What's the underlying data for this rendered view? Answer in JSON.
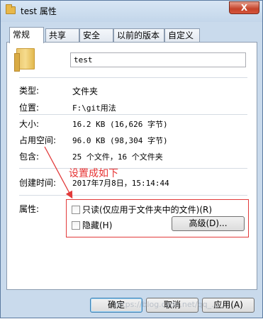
{
  "window": {
    "title": "test 属性",
    "close_label": "X"
  },
  "tabs": [
    {
      "label": "常规",
      "active": true
    },
    {
      "label": "共享",
      "active": false
    },
    {
      "label": "安全",
      "active": false
    },
    {
      "label": "以前的版本",
      "active": false
    },
    {
      "label": "自定义",
      "active": false
    }
  ],
  "general": {
    "folder_name": "test",
    "rows": [
      {
        "label": "类型:",
        "value": "文件夹"
      },
      {
        "label": "位置:",
        "value": "F:\\git用法"
      },
      {
        "label": "大小:",
        "value": "16.2 KB (16,626 字节)"
      },
      {
        "label": "占用空间:",
        "value": "96.0 KB (98,304 字节)"
      },
      {
        "label": "包含:",
        "value": "25 个文件，16 个文件夹"
      },
      {
        "label": "创建时间:",
        "value": "2017年7月8日，15:14:44"
      }
    ],
    "attributes_label": "属性:",
    "readonly_label": "只读(仅应用于文件夹中的文件)(R)",
    "readonly_checked": false,
    "hidden_label": "隐藏(H)",
    "hidden_checked": false,
    "advanced_button": "高级(D)..."
  },
  "annotation": {
    "text": "设置成如下",
    "color": "#e63232"
  },
  "footer": {
    "ok": "确定",
    "cancel": "取消",
    "apply": "应用(A)"
  },
  "watermark": "https://blog.csdn.net/qq_...",
  "colors": {
    "window_frame": "#c9daec",
    "highlight": "#e23a3a"
  }
}
